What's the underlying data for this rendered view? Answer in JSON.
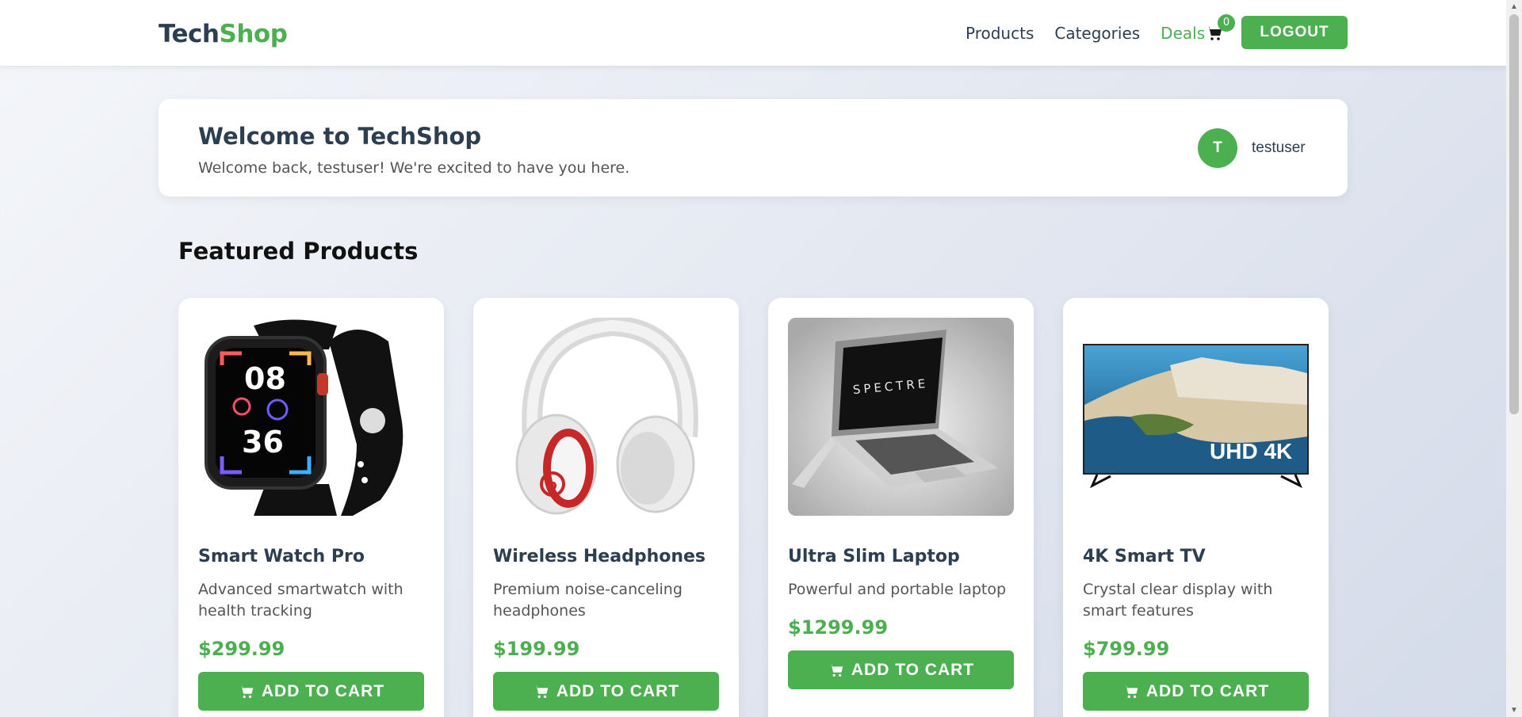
{
  "nav": {
    "logo_part1": "Tech",
    "logo_part2": "Shop",
    "links": [
      "Products",
      "Categories",
      "Deals"
    ],
    "cart_count": "0",
    "logout_label": "LOGOUT",
    "accent_color": "#4caf50"
  },
  "welcome": {
    "title": "Welcome to TechShop",
    "subtitle": "Welcome back, testuser! We're excited to have you here.",
    "avatar_initial": "T",
    "username": "testuser"
  },
  "featured": {
    "title": "Featured Products",
    "add_label": "ADD TO CART",
    "products": [
      {
        "name": "Smart Watch Pro",
        "description": "Advanced smartwatch with health tracking",
        "price": "$299.99",
        "image": "smartwatch"
      },
      {
        "name": "Wireless Headphones",
        "description": "Premium noise-canceling headphones",
        "price": "$199.99",
        "image": "headphones"
      },
      {
        "name": "Ultra Slim Laptop",
        "description": "Powerful and portable laptop",
        "price": "$1299.99",
        "image": "laptop",
        "laptop_brand": "SPECTRE"
      },
      {
        "name": "4K Smart TV",
        "description": "Crystal clear display with smart features",
        "price": "$799.99",
        "image": "tv",
        "tv_label": "UHD 4K"
      }
    ]
  }
}
